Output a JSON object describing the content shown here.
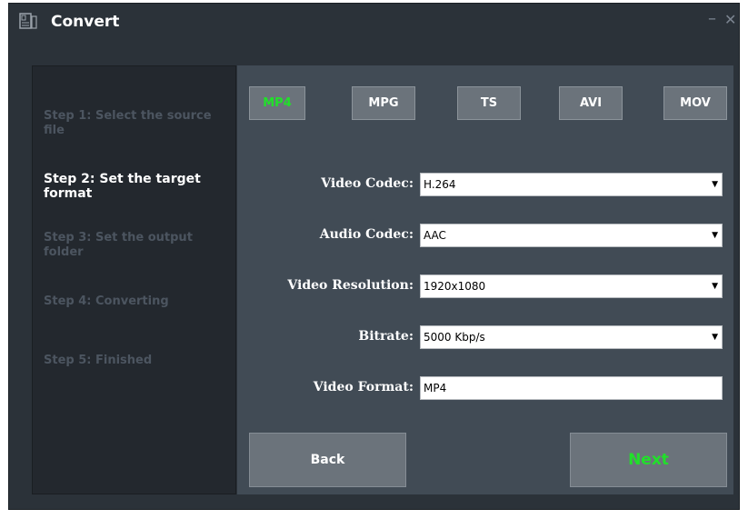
{
  "window": {
    "title": "Convert",
    "minimize_glyph": "–",
    "close_glyph": "✕"
  },
  "steps": [
    {
      "label": "Step 1: Select the source file",
      "state": "inactive"
    },
    {
      "label": "Step 2: Set the target format",
      "state": "active"
    },
    {
      "label": "Step 3: Set the output folder",
      "state": "inactive"
    },
    {
      "label": "Step 4: Converting",
      "state": "inactive"
    },
    {
      "label": "Step 5: Finished",
      "state": "inactive"
    }
  ],
  "formats": [
    {
      "label": "MP4",
      "selected": true
    },
    {
      "label": "MPG",
      "selected": false
    },
    {
      "label": "TS",
      "selected": false
    },
    {
      "label": "AVI",
      "selected": false
    },
    {
      "label": "MOV",
      "selected": false
    }
  ],
  "fields": {
    "video_codec": {
      "label": "Video Codec:",
      "value": "H.264"
    },
    "audio_codec": {
      "label": "Audio Codec:",
      "value": "AAC"
    },
    "video_resolution": {
      "label": "Video Resolution:",
      "value": "1920x1080"
    },
    "bitrate": {
      "label": "Bitrate:",
      "value": "5000 Kbp/s"
    },
    "video_format": {
      "label": "Video Format:",
      "value": "MP4"
    }
  },
  "buttons": {
    "back": "Back",
    "next": "Next"
  },
  "colors": {
    "accent_green": "#21e02a",
    "window_bg": "#2b3239",
    "panel_bg": "#414b55",
    "button_bg": "#6b737b"
  },
  "icons": {
    "app": "convert-app-icon",
    "dropdown": "dropdown-arrow-icon"
  }
}
